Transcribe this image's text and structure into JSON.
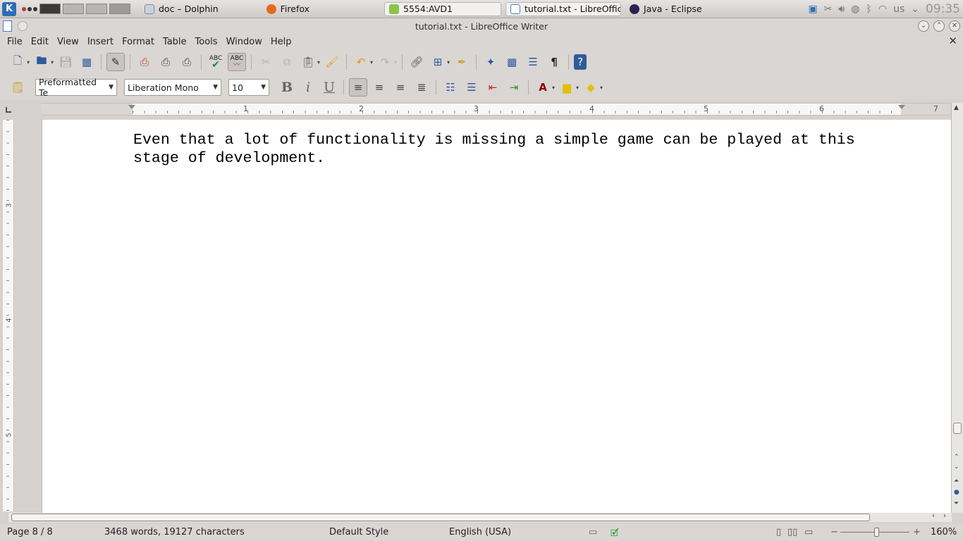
{
  "taskbar": {
    "tasks": [
      {
        "label": "doc – Dolphin"
      },
      {
        "label": "Firefox"
      },
      {
        "label": "5554:AVD1"
      },
      {
        "label": "tutorial.txt - LibreOffice"
      },
      {
        "label": "Java - Eclipse"
      }
    ],
    "keyboard_layout": "us",
    "clock": "09:35"
  },
  "window": {
    "title": "tutorial.txt - LibreOffice Writer"
  },
  "menu": {
    "items": [
      "File",
      "Edit",
      "View",
      "Insert",
      "Format",
      "Table",
      "Tools",
      "Window",
      "Help"
    ]
  },
  "toolbar_standard": {
    "spellcheck_label": "ABC",
    "autospell_label": "ABC"
  },
  "formatting": {
    "paragraph_style": "Preformatted Te",
    "font_name": "Liberation Mono",
    "font_size": "10",
    "bold": "B",
    "italic": "i",
    "underline": "U"
  },
  "ruler": {
    "h_numbers": [
      "1",
      "2",
      "3",
      "4",
      "5",
      "6",
      "7"
    ],
    "v_numbers": [
      "3",
      "4",
      "5"
    ]
  },
  "document": {
    "text": "Even that a lot of functionality is missing a simple game can be played at this\nstage of development."
  },
  "status": {
    "page": "Page 8 / 8",
    "words": "3468 words, 19127 characters",
    "page_style": "Default Style",
    "language": "English (USA)",
    "zoom": "160%"
  },
  "colors": {
    "accent": "#2e5c9a",
    "chrome": "#dad6d4",
    "workspace": "#d6d2d0"
  }
}
